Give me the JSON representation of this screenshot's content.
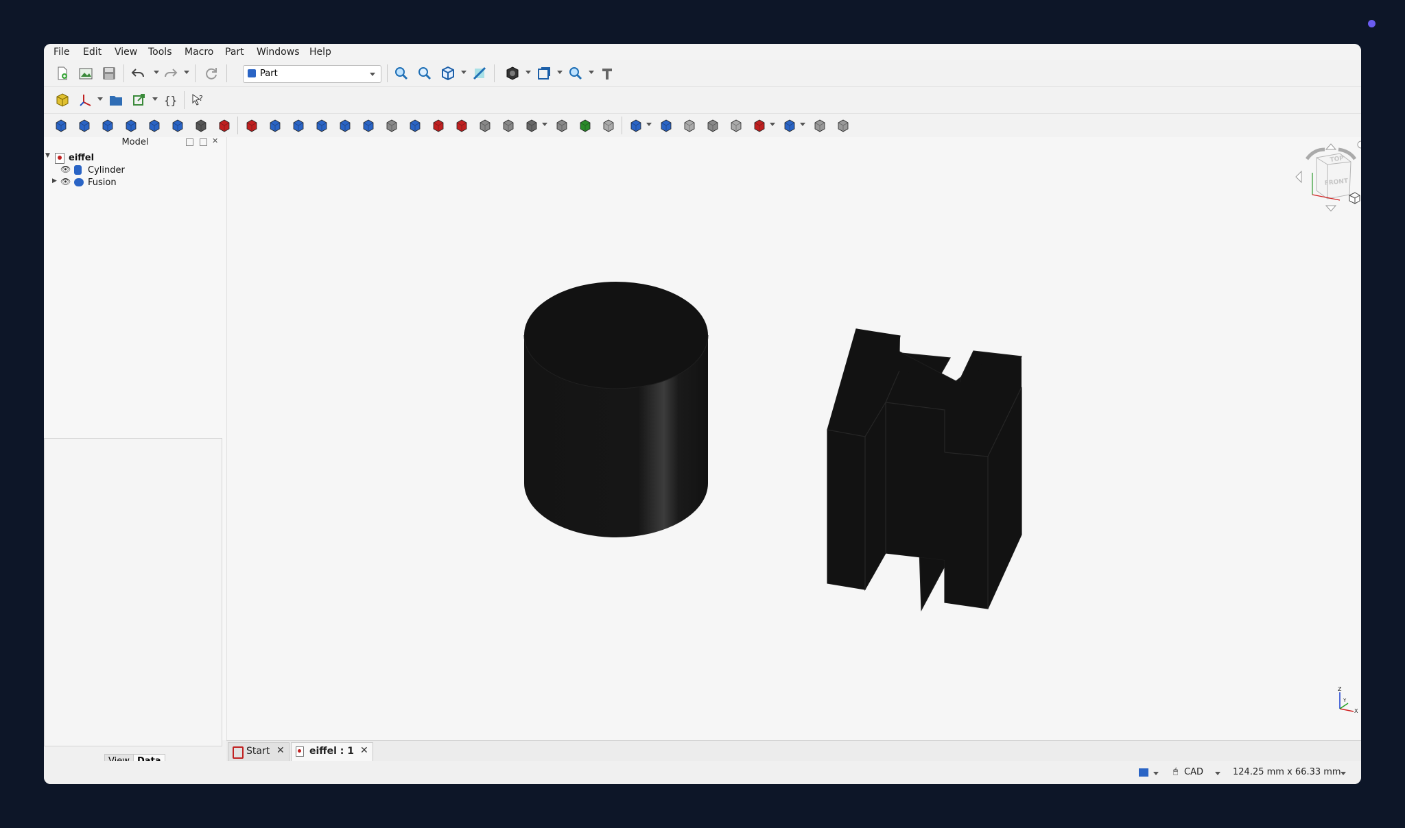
{
  "menu": [
    "File",
    "Edit",
    "View",
    "Tools",
    "Macro",
    "Part",
    "Windows",
    "Help"
  ],
  "workbench": {
    "selected": "Part"
  },
  "icons": {
    "toolbar1": [
      "new-document-icon",
      "open-document-icon",
      "save-icon",
      "undo-icon",
      "redo-icon",
      "refresh-icon",
      "fit-all-icon",
      "fit-selection-icon",
      "view-isometric-icon",
      "measure-icon",
      "draw-style-icon",
      "bounding-box-icon",
      "zoom-icon",
      "std-measure-icon"
    ],
    "toolbar2": [
      "part-icon",
      "axis-icon",
      "group-icon",
      "link-icon",
      "macro-icon",
      "whats-this-icon"
    ],
    "toolbar3": [
      "box-icon",
      "cylinder-icon",
      "sphere-icon",
      "cone-icon",
      "torus-icon",
      "tube-icon",
      "primitives-icon",
      "shape-builder-icon",
      "convert-icon",
      "extrude-icon",
      "revolve-icon",
      "mirror-icon",
      "fillet-icon",
      "chamfer-icon",
      "face-from-edges-icon",
      "ruled-surface-icon",
      "loft-icon",
      "sweep-icon",
      "section-icon",
      "cross-sections-icon",
      "offset-icon",
      "thickness-icon",
      "projection-icon",
      "color-per-face-icon",
      "compound-icon",
      "boolean-icon",
      "cut-icon",
      "fuse-icon",
      "common-icon",
      "join-icon",
      "split-icon",
      "check-geometry-icon",
      "defeaturing-icon"
    ]
  },
  "combo_view": {
    "title": "Model"
  },
  "tree": {
    "document": "eiffel",
    "items": [
      {
        "label": "Cylinder",
        "icon": "cylinder-icon"
      },
      {
        "label": "Fusion",
        "icon": "fusion-icon"
      }
    ]
  },
  "property_tabs": [
    "View",
    "Data"
  ],
  "navcube": {
    "top": "TOP",
    "front": "FRONT"
  },
  "axis": {
    "z": "Z",
    "y": "Y",
    "x": "X"
  },
  "doc_tabs": [
    {
      "label": "Start",
      "icon": "start-icon"
    },
    {
      "label": "eiffel : 1",
      "icon": "document-icon"
    }
  ],
  "status": {
    "nav_style": "CAD",
    "dimensions": "124.25 mm x 66.33 mm"
  },
  "colors": {
    "accent": "#2a64c5",
    "solid": "#121212",
    "background": "#f6f6f6"
  }
}
